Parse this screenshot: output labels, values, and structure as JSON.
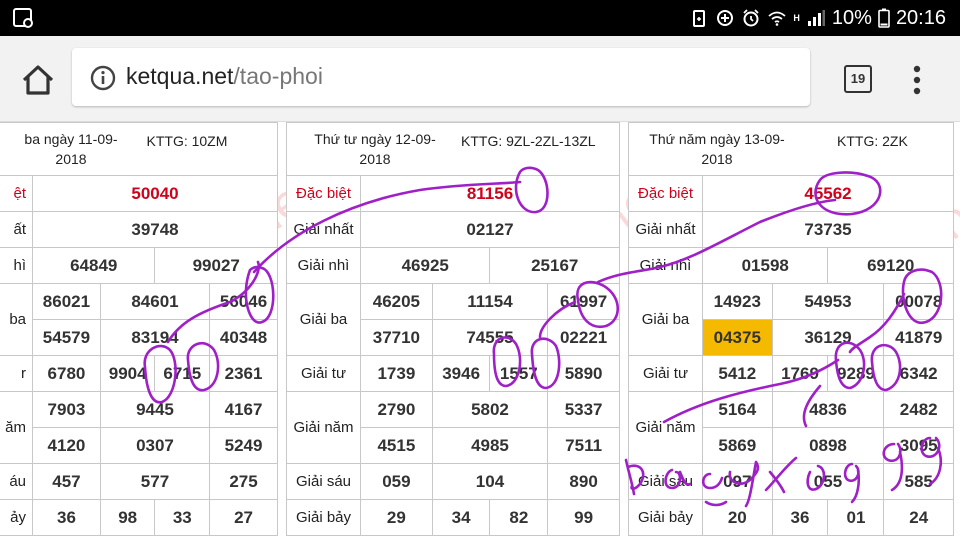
{
  "status_bar": {
    "icons": [
      "gallery-icon",
      "battery-saver-icon",
      "data-saver-icon",
      "alarm-icon",
      "wifi-icon",
      "signal-icon"
    ],
    "network": "H",
    "battery": "10%",
    "time": "20:16"
  },
  "browser": {
    "url_domain": "ketqua.net",
    "url_path": "/tao-phoi",
    "tab_count": "19"
  },
  "watermark": "ketqua.net",
  "handwriting": "bạc nhớ",
  "columns": [
    {
      "header_date": "ba ngày 11-09-",
      "header_year": "2018",
      "kttg": "KTTG: 10ZM",
      "labels": [
        "ệt",
        "ất",
        "hì",
        "ba",
        "",
        "r",
        "ăm",
        "",
        "áu",
        "ảy"
      ],
      "dac_biet": "50040",
      "giai_nhat": "39748",
      "giai_nhi": [
        "64849",
        "99027"
      ],
      "giai_ba": [
        [
          "86021",
          "84601",
          "56046"
        ],
        [
          "54579",
          "83194",
          "40348"
        ]
      ],
      "giai_tu": [
        "6780",
        "9904",
        "6715",
        "2361"
      ],
      "giai_nam": [
        [
          "7903",
          "9445",
          "4167"
        ],
        [
          "4120",
          "0307",
          "5249"
        ]
      ],
      "giai_sau": [
        "457",
        "577",
        "275"
      ],
      "giai_bay": [
        "36",
        "98",
        "33",
        "27"
      ]
    },
    {
      "header_date": "Thứ tư ngày 12-09-",
      "header_year": "2018",
      "kttg": "KTTG: 9ZL-2ZL-13ZL",
      "labels": [
        "Đặc biệt",
        "Giải nhất",
        "Giải nhì",
        "Giải ba",
        "Giải tư",
        "Giải năm",
        "Giải sáu",
        "Giải bảy"
      ],
      "dac_biet": "81156",
      "giai_nhat": "02127",
      "giai_nhi": [
        "46925",
        "25167"
      ],
      "giai_ba": [
        [
          "46205",
          "11154",
          "61997"
        ],
        [
          "37710",
          "74555",
          "02221"
        ]
      ],
      "giai_tu": [
        "1739",
        "3946",
        "1557",
        "5890"
      ],
      "giai_nam": [
        [
          "2790",
          "5802",
          "5337"
        ],
        [
          "4515",
          "4985",
          "7511"
        ]
      ],
      "giai_sau": [
        "059",
        "104",
        "890"
      ],
      "giai_bay": [
        "29",
        "34",
        "82",
        "99"
      ]
    },
    {
      "header_date": "Thứ năm ngày 13-09-",
      "header_year": "2018",
      "kttg": "KTTG: 2ZK",
      "labels": [
        "Đặc biệt",
        "Giải nhất",
        "Giải nhì",
        "Giải ba",
        "Giải tư",
        "Giải năm",
        "Giải sáu",
        "Giải bảy"
      ],
      "dac_biet": "45562",
      "giai_nhat": "73735",
      "giai_nhi": [
        "01598",
        "69120"
      ],
      "giai_ba": [
        [
          "14923",
          "54953",
          "00078"
        ],
        [
          "04375",
          "36129",
          "41879"
        ]
      ],
      "giai_tu": [
        "5412",
        "1769",
        "9289",
        "6342"
      ],
      "giai_nam": [
        [
          "5164",
          "4836",
          "2482"
        ],
        [
          "5869",
          "0898",
          "3095"
        ]
      ],
      "giai_sau": [
        "097",
        "055",
        "585"
      ],
      "giai_bay": [
        "20",
        "36",
        "01",
        "24"
      ]
    }
  ]
}
